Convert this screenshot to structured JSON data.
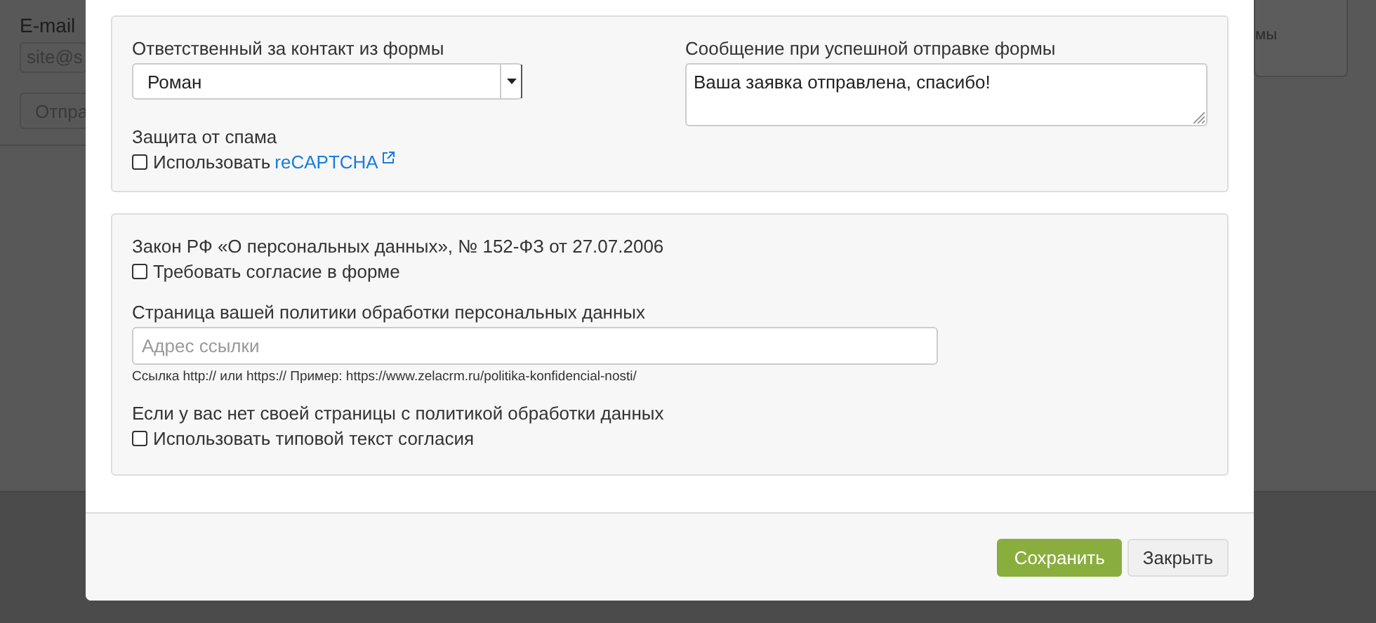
{
  "background_page": {
    "email_label": "E-mail",
    "email_value": "site@s",
    "send_button": "Отпра",
    "side_text": "мы"
  },
  "modal": {
    "responsible": {
      "label": "Ответственный за контакт из формы",
      "value": "Роман"
    },
    "success_message": {
      "label": "Сообщение при успешной отправке формы",
      "value": "Ваша заявка отправлена, спасибо!"
    },
    "spam": {
      "label": "Защита от спама",
      "checkbox_label": "Использовать",
      "link": "reCAPTCHA",
      "checked": false
    },
    "law": {
      "label": "Закон РФ «О персональных данных», № 152-ФЗ от 27.07.2006",
      "checkbox_label": "Требовать согласие в форме",
      "checked": false
    },
    "policy_page": {
      "label": "Страница вашей политики обработки персональных данных",
      "placeholder": "Адрес ссылки",
      "hint": "Ссылка http:// или https:// Пример: https://www.zelacrm.ru/politika-konfidencial-nosti/"
    },
    "no_policy": {
      "label": "Если у вас нет своей страницы с политикой обработки данных",
      "checkbox_label": "Использовать типовой текст согласия",
      "checked": false
    },
    "buttons": [
      {
        "label": "Сохранить",
        "kind": "primary"
      },
      {
        "label": "Закрыть",
        "kind": "default"
      }
    ]
  }
}
